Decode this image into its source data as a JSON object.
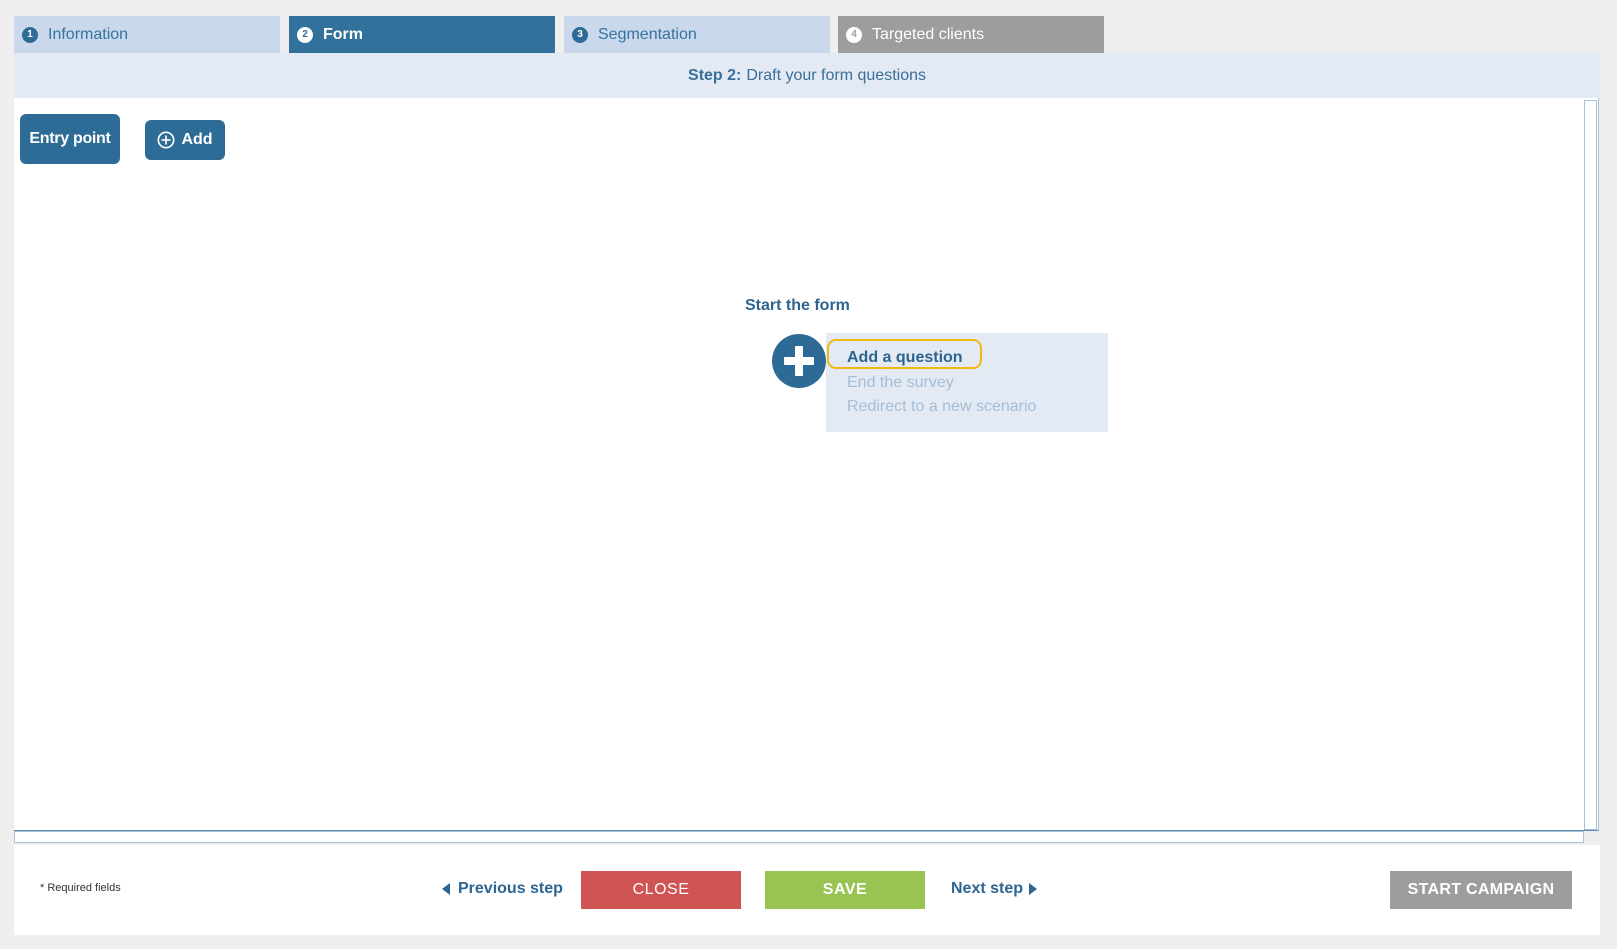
{
  "tabs": [
    {
      "number": "1",
      "label": "Information",
      "state": "completed"
    },
    {
      "number": "2",
      "label": "Form",
      "state": "active"
    },
    {
      "number": "3",
      "label": "Segmentation",
      "state": "pending"
    },
    {
      "number": "4",
      "label": "Targeted clients",
      "state": "disabled"
    }
  ],
  "step": {
    "prefix": "Step 2:",
    "text": "Draft your form questions"
  },
  "canvas": {
    "entry_point_label": "Entry point",
    "add_label": "Add",
    "start_label": "Start the form",
    "menu": {
      "items": [
        "Add a question",
        "End the survey",
        "Redirect to a new scenario"
      ],
      "highlighted_index": 0
    }
  },
  "footer": {
    "required_note": "* Required fields",
    "previous_label": "Previous step",
    "close_label": "CLOSE",
    "save_label": "SAVE",
    "next_label": "Next step",
    "start_campaign_label": "START CAMPAIGN"
  },
  "colors": {
    "primary": "#2e6c98",
    "tab_light": "#c9d8ea",
    "close": "#d15454",
    "save": "#99c454",
    "disabled": "#9d9d9d",
    "highlight": "#f2b812"
  }
}
